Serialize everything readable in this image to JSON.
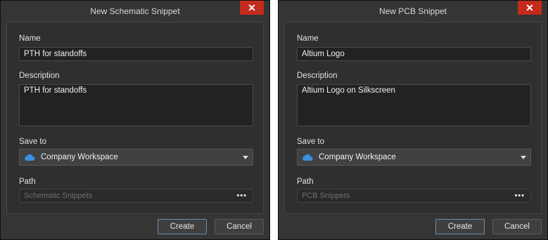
{
  "dialogs": [
    {
      "title": "New Schematic Snippet",
      "close_glyph": "✕",
      "name_label": "Name",
      "name_value": "PTH for standoffs",
      "description_label": "Description",
      "description_value": "PTH for standoffs",
      "save_to_label": "Save to",
      "save_to_value": "Company Workspace",
      "save_to_icon": "cloud-icon",
      "path_label": "Path",
      "path_value": "Schematic Snippets",
      "path_browse": "•••",
      "create_label": "Create",
      "cancel_label": "Cancel"
    },
    {
      "title": "New PCB Snippet",
      "close_glyph": "✕",
      "name_label": "Name",
      "name_value": "Altium Logo",
      "description_label": "Description",
      "description_value": "Altium Logo on Silkscreen",
      "save_to_label": "Save to",
      "save_to_value": "Company Workspace",
      "save_to_icon": "cloud-icon",
      "path_label": "Path",
      "path_value": "PCB Snippets",
      "path_browse": "•••",
      "create_label": "Create",
      "cancel_label": "Cancel"
    }
  ],
  "colors": {
    "dialog_bg": "#353535",
    "panel_bg": "#2f2f2f",
    "close_red": "#c42b1c",
    "cloud_blue": "#3d8fe0"
  }
}
